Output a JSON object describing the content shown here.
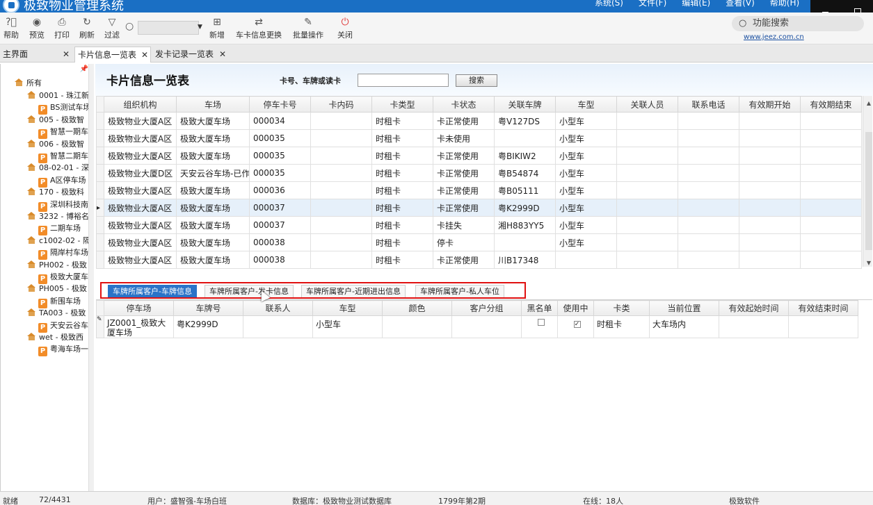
{
  "window": {
    "title": "极致物业管理系统",
    "menus": [
      "系统(S)",
      "文件(F)",
      "编辑(E)",
      "查看(V)",
      "帮助(H)"
    ]
  },
  "toolbar": {
    "buttons": [
      {
        "label": "帮助",
        "icon": "help-icon"
      },
      {
        "label": "预览",
        "icon": "eye-icon"
      },
      {
        "label": "打印",
        "icon": "printer-icon"
      },
      {
        "label": "刷新",
        "icon": "refresh-icon"
      },
      {
        "label": "过滤",
        "icon": "filter-icon"
      },
      {
        "label": "新增",
        "icon": "add-icon"
      },
      {
        "label": "车卡信息更换",
        "icon": "swap-icon"
      },
      {
        "label": "批量操作",
        "icon": "edit-icon"
      },
      {
        "label": "关闭",
        "icon": "power-icon"
      }
    ],
    "search_value": "",
    "func_search": "功能搜索",
    "website": "www.jeez.com.cn"
  },
  "tabs": [
    {
      "label": "主界面"
    },
    {
      "label": "卡片信息一览表"
    },
    {
      "label": "发卡记录一览表"
    }
  ],
  "tree": {
    "root": "所有",
    "items": [
      {
        "kind": "house",
        "label": "0001 - 珠江新"
      },
      {
        "kind": "p",
        "label": "BS测试车场"
      },
      {
        "kind": "house",
        "label": "005 - 极致智"
      },
      {
        "kind": "p",
        "label": "智慧一期车"
      },
      {
        "kind": "house",
        "label": "006 - 极致智"
      },
      {
        "kind": "p",
        "label": "智慧二期车"
      },
      {
        "kind": "house",
        "label": "08-02-01 - 深"
      },
      {
        "kind": "p",
        "label": "A区停车场"
      },
      {
        "kind": "house",
        "label": "170 - 极致科"
      },
      {
        "kind": "p",
        "label": "深圳科技南"
      },
      {
        "kind": "house",
        "label": "3232 - 博裕名"
      },
      {
        "kind": "p",
        "label": "二期车场"
      },
      {
        "kind": "house",
        "label": "c1002-02 - 隔"
      },
      {
        "kind": "p",
        "label": "隔岸村车场"
      },
      {
        "kind": "house",
        "label": "PH002 - 极致"
      },
      {
        "kind": "p",
        "label": "极致大厦车"
      },
      {
        "kind": "house",
        "label": "PH005 - 极致"
      },
      {
        "kind": "p",
        "label": "新围车场"
      },
      {
        "kind": "house",
        "label": "TA003 - 极致"
      },
      {
        "kind": "p",
        "label": "天安云谷车"
      },
      {
        "kind": "house",
        "label": "wet - 极致西"
      },
      {
        "kind": "p",
        "label": "粤海车场一"
      }
    ]
  },
  "page": {
    "title": "卡片信息一览表",
    "query_label": "卡号、车牌或读卡",
    "query_value": "",
    "search_button": "搜索"
  },
  "grid1": {
    "columns": [
      "组织机构",
      "车场",
      "停车卡号",
      "卡内码",
      "卡类型",
      "卡状态",
      "关联车牌",
      "车型",
      "关联人员",
      "联系电话",
      "有效期开始",
      "有效期结束"
    ],
    "rows": [
      [
        "极致物业大厦A区",
        "极致大厦车场",
        "000034",
        "",
        "时租卡",
        "卡正常使用",
        "粤V127DS",
        "小型车",
        "",
        "",
        "",
        ""
      ],
      [
        "极致物业大厦A区",
        "极致大厦车场",
        "000035",
        "",
        "时租卡",
        "卡未使用",
        "",
        "小型车",
        "",
        "",
        "",
        ""
      ],
      [
        "极致物业大厦A区",
        "极致大厦车场",
        "000035",
        "",
        "时租卡",
        "卡正常使用",
        "粤BIKIW2",
        "小型车",
        "",
        "",
        "",
        ""
      ],
      [
        "极致物业大厦D区",
        "天安云谷车场-已作废",
        "000035",
        "",
        "时租卡",
        "卡正常使用",
        "粤B54874",
        "小型车",
        "",
        "",
        "",
        ""
      ],
      [
        "极致物业大厦A区",
        "极致大厦车场",
        "000036",
        "",
        "时租卡",
        "卡正常使用",
        "粤B05111",
        "小型车",
        "",
        "",
        "",
        ""
      ],
      [
        "极致物业大厦A区",
        "极致大厦车场",
        "000037",
        "",
        "时租卡",
        "卡正常使用",
        "粤K2999D",
        "小型车",
        "",
        "",
        "",
        ""
      ],
      [
        "极致物业大厦A区",
        "极致大厦车场",
        "000037",
        "",
        "时租卡",
        "卡挂失",
        "湘H883YY5",
        "小型车",
        "",
        "",
        "",
        ""
      ],
      [
        "极致物业大厦A区",
        "极致大厦车场",
        "000038",
        "",
        "时租卡",
        "停卡",
        "",
        "小型车",
        "",
        "",
        "",
        ""
      ],
      [
        "极致物业大厦A区",
        "极致大厦车场",
        "000038",
        "",
        "时租卡",
        "卡正常使用",
        "川B17348",
        "",
        "",
        "",
        "",
        ""
      ]
    ],
    "selected_row": 5
  },
  "subtabs": [
    "车牌所属客户-车牌信息",
    "车牌所属客户-发卡信息",
    "车牌所属客户-近期进出信息",
    "车牌所属客户-私人车位"
  ],
  "grid2": {
    "columns": [
      "停车场",
      "车牌号",
      "联系人",
      "车型",
      "颜色",
      "客户分组",
      "黑名单",
      "使用中",
      "卡类",
      "当前位置",
      "有效起始时间",
      "有效结束时间"
    ],
    "rows": [
      {
        "lot": "JZ0001_极致大厦车场",
        "plate": "粤K2999D",
        "contact": "",
        "type": "小型车",
        "color": "",
        "group": "",
        "blacklist": false,
        "inuse": true,
        "cardtype": "时租卡",
        "location": "大车场内",
        "start": "",
        "end": ""
      }
    ]
  },
  "status": {
    "state": "就绪",
    "count": "72/4431",
    "user": "用户：盛智强-车场白班",
    "db": "数据库：极致物业测试数据库",
    "period": "1799年第2期",
    "online": "在线：18人",
    "company": "极致软件"
  }
}
